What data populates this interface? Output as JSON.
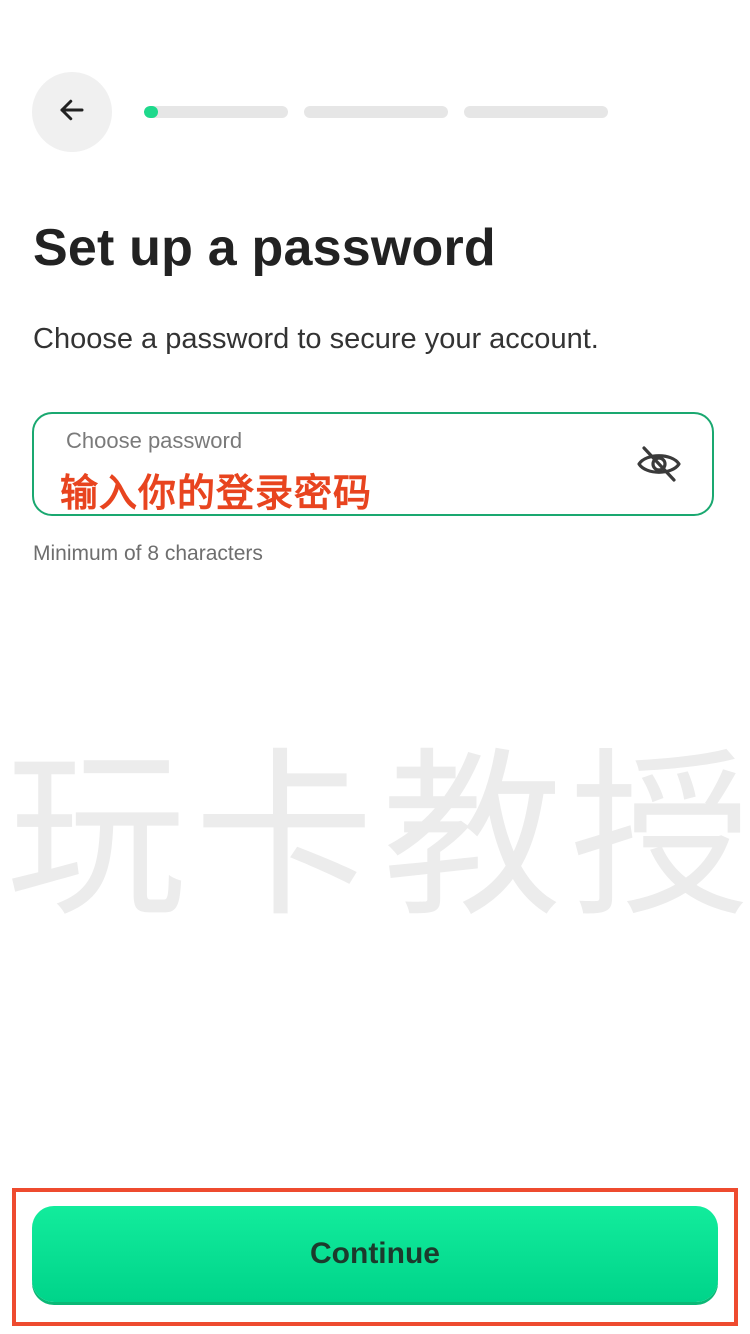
{
  "header": {
    "back_icon": "arrow-left-icon",
    "progress": {
      "total_steps": 3,
      "current_step": 1,
      "first_step_fill_fraction": 0.1
    }
  },
  "title": "Set up a password",
  "subtitle": "Choose a password to secure your account.",
  "password_field": {
    "label": "Choose password",
    "value": "输入你的登录密码",
    "visibility_icon": "eye-off-icon"
  },
  "hint": "Minimum of 8 characters",
  "watermark": "玩卡教授",
  "continue_button": {
    "label": "Continue"
  },
  "colors": {
    "accent": "#1ed98c",
    "field_border": "#1aa870",
    "annotation_red": "#e8441f"
  }
}
